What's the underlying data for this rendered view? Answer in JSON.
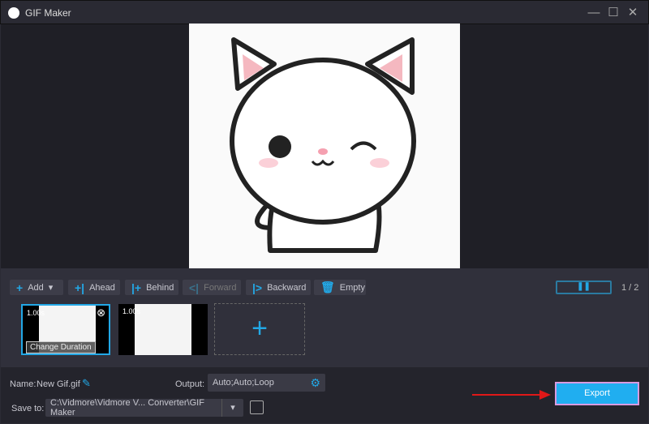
{
  "window": {
    "title": "GIF Maker",
    "logo": "Vm"
  },
  "toolbar": {
    "add": "Add",
    "ahead": "Ahead",
    "behind": "Behind",
    "forward": "Forward",
    "backward": "Backward",
    "empty": "Empty"
  },
  "pager": "1 / 2",
  "frames": [
    {
      "duration": "1.00s",
      "selected": true,
      "overlay": "Change Duration"
    },
    {
      "duration": "1.00s",
      "selected": false
    }
  ],
  "bottom": {
    "name_label": "Name:",
    "name_value": "New Gif.gif",
    "output_label": "Output:",
    "output_value": "Auto;Auto;Loop",
    "save_label": "Save to:",
    "save_path": "C:\\Vidmore\\Vidmore V... Converter\\GIF Maker",
    "export": "Export"
  },
  "colors": {
    "accent": "#22a8e6",
    "export_bg": "#20aef0",
    "arrow": "#e01818"
  }
}
